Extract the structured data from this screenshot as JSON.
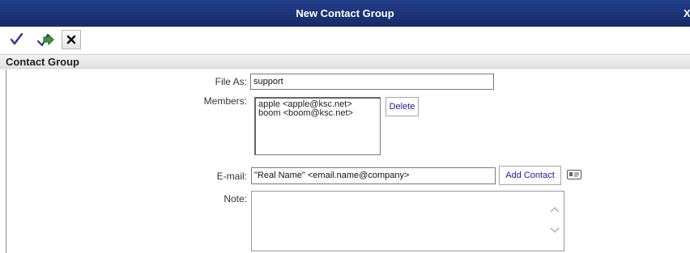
{
  "window": {
    "title": "New Contact Group",
    "close_label": "X"
  },
  "toolbar": {
    "save_icon": "checkmark-icon",
    "save_as_icon": "save-arrow-icon",
    "cancel_icon": "x-icon"
  },
  "section": {
    "title": "Contact Group"
  },
  "form": {
    "file_as_label": "File As:",
    "file_as_value": "support",
    "members_label": "Members:",
    "members": [
      "apple <apple@ksc.net>",
      "boom <boom@ksc.net>"
    ],
    "delete_label": "Delete",
    "email_label": "E-mail:",
    "email_value": "\"Real Name\" <email.name@company>",
    "add_contact_label": "Add Contact",
    "address_book_icon": "address-book-icon",
    "note_label": "Note:",
    "note_value": ""
  },
  "colors": {
    "titlebar": "#17317a",
    "link_text": "#1a1aa6"
  }
}
